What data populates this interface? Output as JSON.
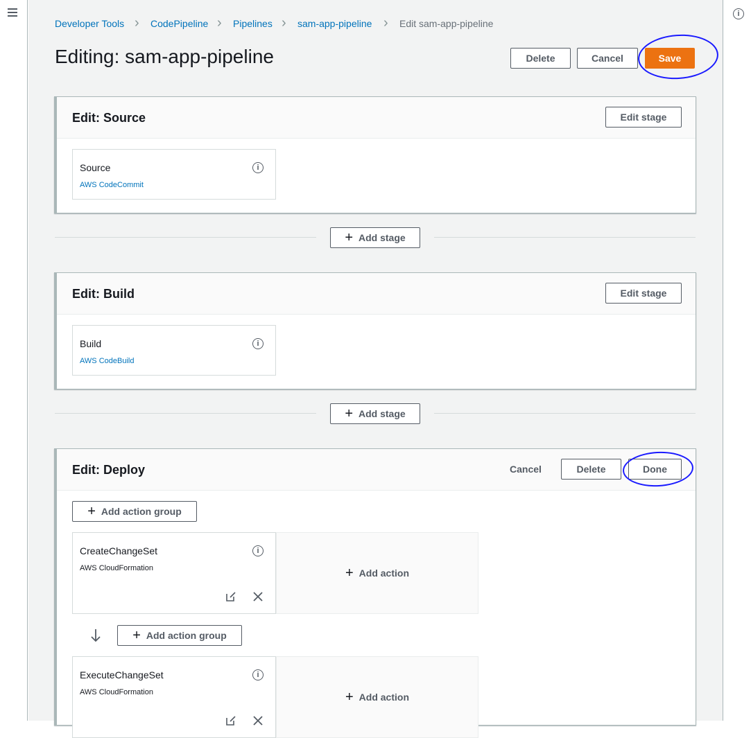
{
  "breadcrumbs": {
    "items": [
      "Developer Tools",
      "CodePipeline",
      "Pipelines",
      "sam-app-pipeline",
      "Edit sam-app-pipeline"
    ],
    "separator": ">"
  },
  "header": {
    "title": "Editing: sam-app-pipeline",
    "delete_label": "Delete",
    "cancel_label": "Cancel",
    "save_label": "Save"
  },
  "stages": {
    "source": {
      "title": "Edit: Source",
      "edit_label": "Edit stage",
      "action": {
        "name": "Source",
        "provider": "AWS CodeCommit"
      }
    },
    "build": {
      "title": "Edit: Build",
      "edit_label": "Edit stage",
      "action": {
        "name": "Build",
        "provider": "AWS CodeBuild"
      }
    },
    "deploy": {
      "title": "Edit: Deploy",
      "cancel_label": "Cancel",
      "delete_label": "Delete",
      "done_label": "Done",
      "add_action_group_label": "Add action group",
      "groups": [
        {
          "name": "CreateChangeSet",
          "provider": "AWS CloudFormation",
          "add_action_label": "Add action"
        },
        {
          "name": "ExecuteChangeSet",
          "provider": "AWS CloudFormation",
          "add_action_label": "Add action"
        }
      ]
    }
  },
  "add_stage_label": "Add stage",
  "icons": {
    "info": "info-icon",
    "plus": "plus-icon",
    "edit": "edit-icon",
    "close": "close-icon",
    "arrow_down": "arrow-down-icon",
    "menu": "menu-icon"
  },
  "colors": {
    "primary": "#ec7211",
    "link": "#0073bb",
    "annotation": "#1a1aff"
  }
}
